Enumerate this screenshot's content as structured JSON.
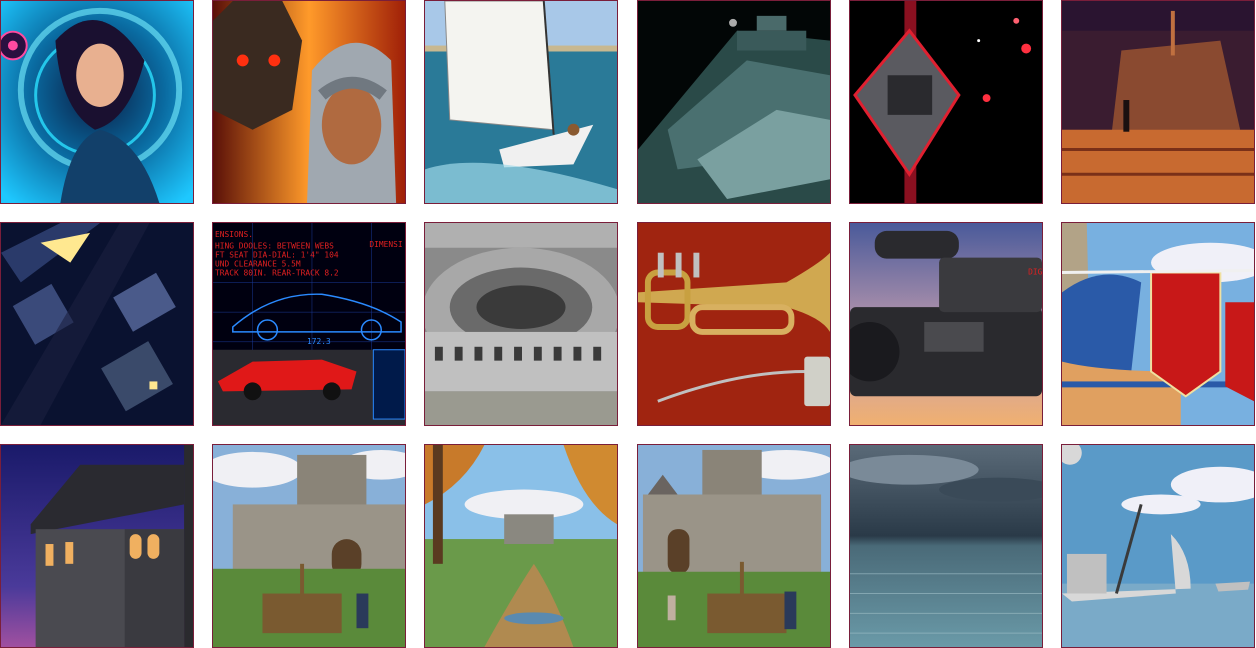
{
  "gallery": {
    "tiles": [
      {
        "id": "cosmic-woman",
        "icon": "portrait-icon",
        "accent": "#1ec8ff"
      },
      {
        "id": "armored-warriors",
        "icon": "portrait-icon",
        "accent": "#ff7a1a"
      },
      {
        "id": "windsurfer",
        "icon": "sail-icon",
        "accent": "#3a8fb0"
      },
      {
        "id": "star-destroyer",
        "icon": "spaceship-icon",
        "accent": "#4a8a8a"
      },
      {
        "id": "space-station",
        "icon": "satellite-icon",
        "accent": "#e0203a"
      },
      {
        "id": "hangar-ship",
        "icon": "factory-icon",
        "accent": "#c46a3a"
      },
      {
        "id": "city-rooftops",
        "icon": "city-icon",
        "accent": "#2a4a8a"
      },
      {
        "id": "car-blueprint",
        "icon": "car-icon",
        "accent": "#e02020"
      },
      {
        "id": "colosseum",
        "icon": "arena-icon",
        "accent": "#8a8a8a"
      },
      {
        "id": "trumpet",
        "icon": "trumpet-icon",
        "accent": "#c8a040"
      },
      {
        "id": "camcorder",
        "icon": "camera-icon",
        "accent": "#3a3a3a"
      },
      {
        "id": "lion-banners",
        "icon": "flag-icon",
        "accent": "#c02020"
      },
      {
        "id": "night-tower",
        "icon": "tower-icon",
        "accent": "#3a2a7a"
      },
      {
        "id": "castle-catapult",
        "icon": "castle-icon",
        "accent": "#7a9a4a"
      },
      {
        "id": "autumn-castle",
        "icon": "castle-icon",
        "accent": "#c87a2a"
      },
      {
        "id": "castle-gate",
        "icon": "castle-icon",
        "accent": "#6a8a3a"
      },
      {
        "id": "stormy-sea",
        "icon": "sea-icon",
        "accent": "#5a7a8a"
      },
      {
        "id": "galley-ship",
        "icon": "ship-icon",
        "accent": "#5a9ac8"
      }
    ],
    "blueprint_text": {
      "line1": "ENSIONS.",
      "line2": "HING DOOLES: BETWEEN WEBS",
      "line3": "FT SEAT DIA-DIAL: 1'4\" 104",
      "line4": "UND CLEARANCE  5.5M",
      "line5": "TRACK 80IN. REAR-TRACK 8.2",
      "side": "DIMENSI",
      "mark": "172.3"
    },
    "camcorder_label": "DIG"
  }
}
